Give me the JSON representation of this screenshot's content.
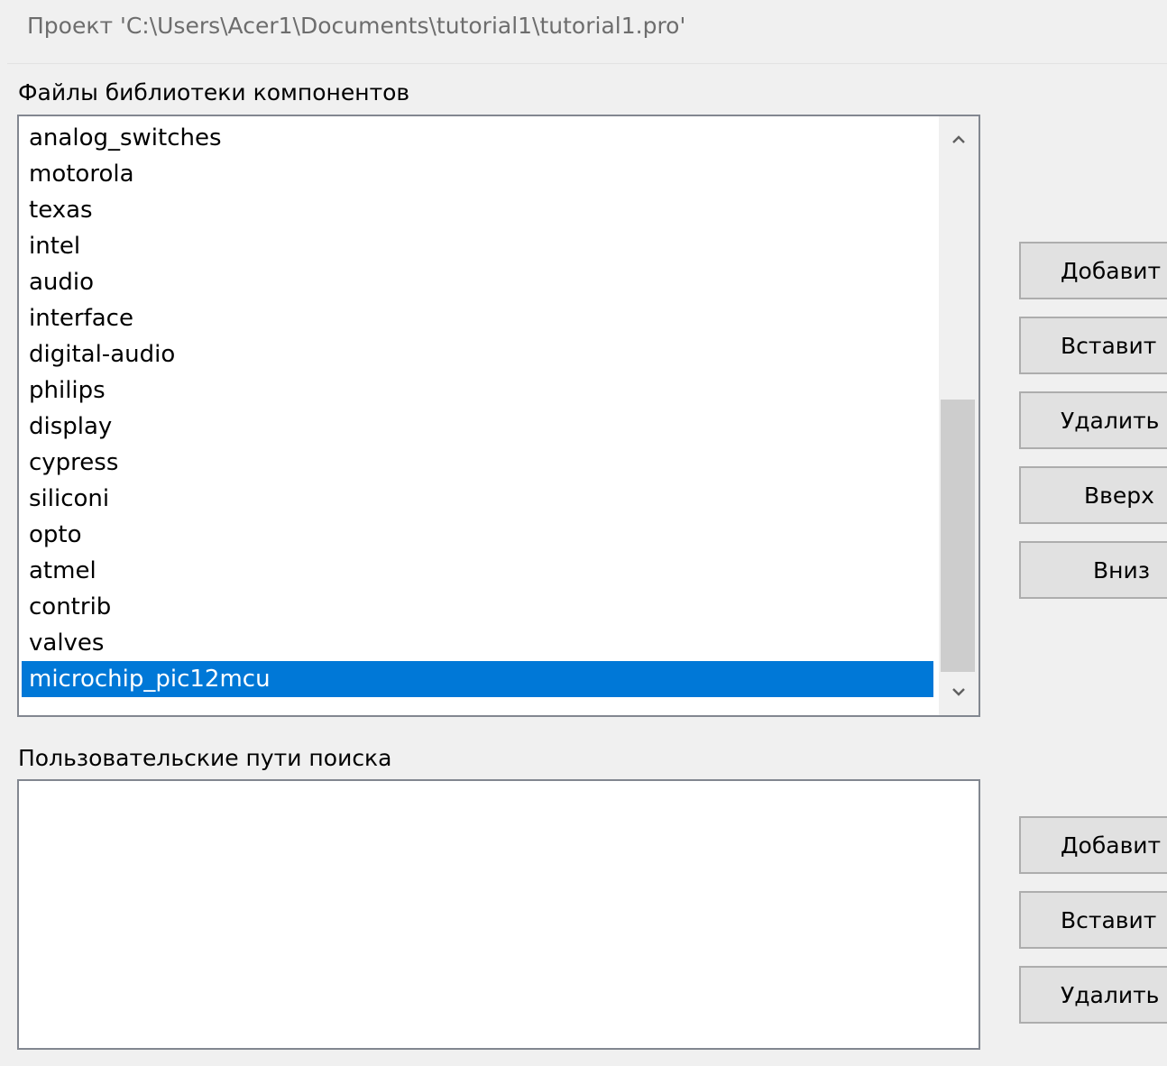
{
  "header": {
    "project_title": "Проект 'C:\\Users\\Acer1\\Documents\\tutorial1\\tutorial1.pro'"
  },
  "libraries": {
    "label": "Файлы библиотеки компонентов",
    "items": [
      "analog_switches",
      "motorola",
      "texas",
      "intel",
      "audio",
      "interface",
      "digital-audio",
      "philips",
      "display",
      "cypress",
      "siliconi",
      "opto",
      "atmel",
      "contrib",
      "valves",
      "microchip_pic12mcu"
    ],
    "selected": "microchip_pic12mcu",
    "buttons": {
      "add": "Добавит",
      "insert": "Вставит",
      "remove": "Удалить",
      "up": "Вверх",
      "down": "Вниз"
    }
  },
  "user_paths": {
    "label": "Пользовательские пути поиска",
    "items": [],
    "buttons": {
      "add": "Добавит",
      "insert": "Вставит",
      "remove": "Удалить"
    }
  },
  "colors": {
    "selection": "#0078d7",
    "background": "#f0f0f0"
  }
}
